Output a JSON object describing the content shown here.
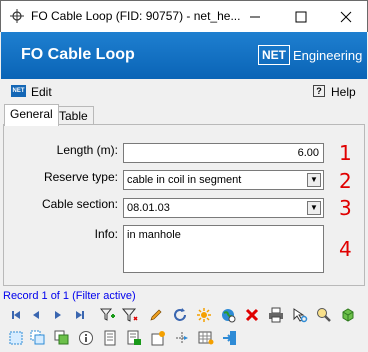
{
  "window": {
    "title": "FO Cable Loop (FID: 90757) - net_he..."
  },
  "banner": {
    "title": "FO Cable Loop",
    "logo_box": "NET",
    "logo_text": "Engineering"
  },
  "menu": {
    "edit_label": "Edit",
    "help_label": "Help"
  },
  "tabs": [
    {
      "label": "General"
    },
    {
      "label": "Table"
    }
  ],
  "form": {
    "length": {
      "label": "Length (m):",
      "value": "6.00",
      "marker": "1"
    },
    "reserve_type": {
      "label": "Reserve type:",
      "value": "cable in coil in segment",
      "marker": "2"
    },
    "cable_section": {
      "label": "Cable section:",
      "value": "08.01.03",
      "marker": "3"
    },
    "info": {
      "label": "Info:",
      "value": "in manhole",
      "marker": "4"
    }
  },
  "status": {
    "record_text": "Record 1 of 1 (Filter active)"
  },
  "colors": {
    "banner_blue": "#0a64b6",
    "marker_red": "#e00000",
    "status_blue": "#0000ee"
  },
  "toolbar_row1_icons": [
    "first-record-icon",
    "previous-record-icon",
    "next-record-icon",
    "last-record-icon",
    "add-filter-icon",
    "filter-icon",
    "edit-pencil-icon",
    "refresh-icon",
    "highlight-icon",
    "globe-icon",
    "delete-icon",
    "print-icon",
    "select-icon",
    "zoom-icon",
    "3d-cube-icon"
  ],
  "toolbar_row2_icons": [
    "select-area-icon",
    "copy-icon",
    "paste-icon",
    "info-icon",
    "document-icon",
    "add-document-icon",
    "new-object-icon",
    "move-icon",
    "table-settings-icon",
    "exit-icon"
  ]
}
